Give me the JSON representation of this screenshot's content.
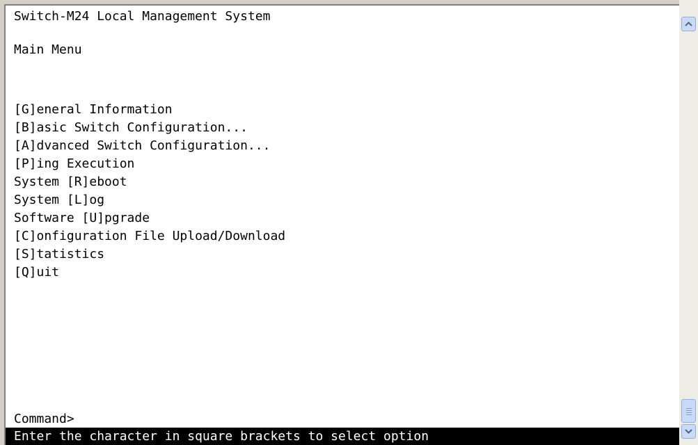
{
  "terminal": {
    "title": "Switch-M24 Local Management System",
    "menu_heading": "Main Menu",
    "menu_items": [
      "[G]eneral Information",
      "[B]asic Switch Configuration...",
      "[A]dvanced Switch Configuration...",
      "[P]ing Execution",
      "System [R]eboot",
      "System [L]og",
      "Software [U]pgrade",
      "[C]onfiguration File Upload/Download",
      "[S]tatistics",
      "[Q]uit"
    ],
    "prompt": "Command>",
    "status_message": "Enter the character in square brackets to select option"
  },
  "colors": {
    "background": "#ffffff",
    "text": "#000000",
    "status_bar_background": "#000000",
    "status_bar_text": "#ffffff",
    "scrollbar_track": "#eeede5",
    "scrollbar_button": "#c9daf7"
  },
  "icons": {
    "scroll_up": "arrow-up-icon",
    "scroll_down": "arrow-down-icon"
  }
}
